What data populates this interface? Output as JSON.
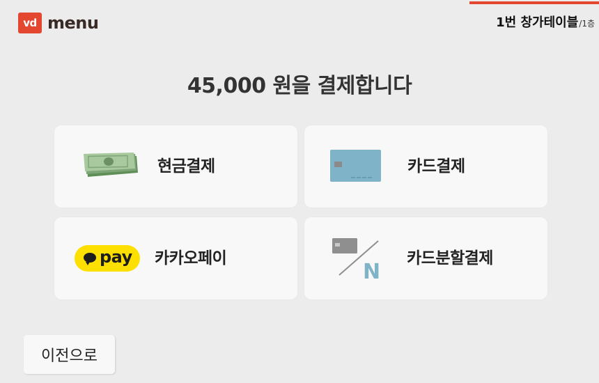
{
  "header": {
    "logo_badge": "vd",
    "logo_text": "menu",
    "table_name": "1번 창가테이블",
    "table_floor": "/1층",
    "accent_color": "#e4472f"
  },
  "title": "45,000 원을 결제합니다",
  "payment_options": [
    {
      "label": "현금결제",
      "icon": "cash-icon"
    },
    {
      "label": "카드결제",
      "icon": "credit-card-icon"
    },
    {
      "label": "카카오페이",
      "icon": "kakaopay-logo",
      "logo_text": "pay"
    },
    {
      "label": "카드분할결제",
      "icon": "split-card-icon",
      "icon_letter": "N"
    }
  ],
  "back_button": "이전으로"
}
